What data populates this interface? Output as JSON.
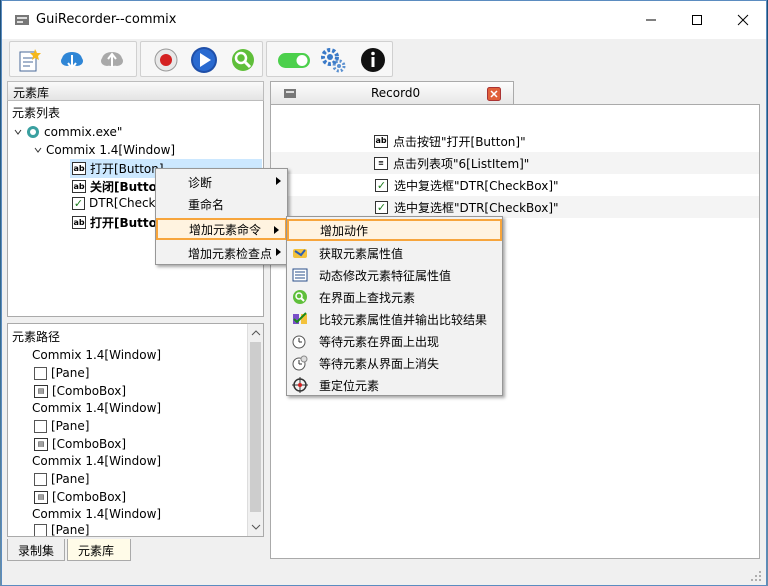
{
  "window": {
    "title": "GuiRecorder--commix"
  },
  "left_panel": {
    "header": "元素库",
    "tree_title": "元素列表",
    "tree": {
      "root": "commix.exe\"",
      "window": "Commix 1.4[Window]",
      "items": [
        "打开[Button]",
        "关闭[Button]",
        "DTR[Check",
        "打开[Button"
      ]
    },
    "path_title": "元素路径",
    "path_items": [
      "Commix 1.4[Window]",
      "[Pane]",
      "[ComboBox]",
      "Commix 1.4[Window]",
      "[Pane]",
      "[ComboBox]",
      "Commix 1.4[Window]",
      "[Pane]",
      "[ComboBox]",
      "Commix 1.4[Window]",
      "[Pane]"
    ],
    "tabs": [
      "录制集",
      "元素库"
    ]
  },
  "right_panel": {
    "tab_label": "Record0",
    "lines": [
      "点击按钮\"打开[Button]\"",
      "点击列表项\"6[ListItem]\"",
      "选中复选框\"DTR[CheckBox]\"",
      "选中复选框\"DTR[CheckBox]\""
    ]
  },
  "context_menu": {
    "items": [
      "诊断",
      "重命名",
      "增加元素命令",
      "增加元素检查点"
    ]
  },
  "submenu": {
    "items": [
      "增加动作",
      "获取元素属性值",
      "动态修改元素特征属性值",
      "在界面上查找元素",
      "比较元素属性值并输出比较结果",
      "等待元素在界面上出现",
      "等待元素从界面上消失",
      "重定位元素"
    ]
  },
  "colors": {
    "highlight": "#f7a53c",
    "selection": "#cce8ff",
    "toggle": "#4cd04c"
  }
}
